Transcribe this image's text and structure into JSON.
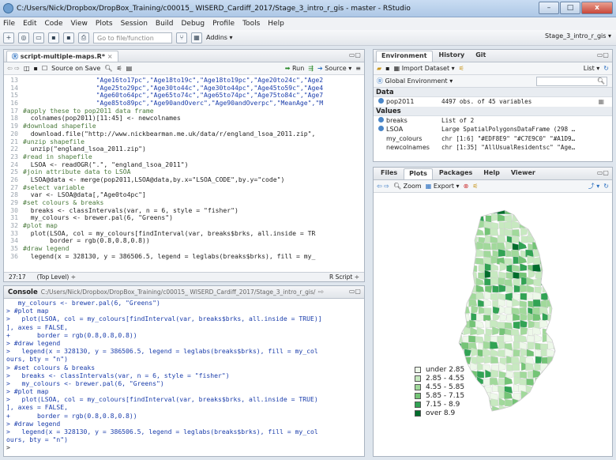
{
  "window": {
    "title": "C:/Users/Nick/Dropbox/DropBox_Training/c00015_ WISERD_Cardiff_2017/Stage_3_intro_r_gis - master - RStudio",
    "minimize": "–",
    "maximize": "□",
    "close": "x"
  },
  "menu": [
    "File",
    "Edit",
    "Code",
    "View",
    "Plots",
    "Session",
    "Build",
    "Debug",
    "Profile",
    "Tools",
    "Help"
  ],
  "toolbar": {
    "goto_placeholder": "Go to file/function",
    "addins": "Addins ▾",
    "project": "Stage_3_intro_r_gis ▾"
  },
  "editor": {
    "tab": "script-multiple-maps.R*",
    "source_on_save": "Source on Save",
    "run": "Run",
    "source": "Source ▾",
    "lines": [
      {
        "n": "13",
        "t": "                   \"Age16to17pc\",\"Age18to19c\",\"Age18to19pc\",\"Age20to24c\",\"Age2",
        "cls": "st"
      },
      {
        "n": "14",
        "t": "                   \"Age25to29pc\",\"Age30to44c\",\"Age30to44pc\",\"Age45to59c\",\"Age4",
        "cls": "st"
      },
      {
        "n": "15",
        "t": "                   \"Age60to64pc\",\"Age65to74c\",\"Age65to74pc\",\"Age75to84c\",\"Age7",
        "cls": "st"
      },
      {
        "n": "16",
        "t": "                   \"Age85to89pc\",\"Age90andOverc\",\"Age90andOverpc\",\"MeanAge\",\"M",
        "cls": "st"
      },
      {
        "n": "17",
        "t": "#apply these to pop2011 data frame",
        "cls": "cm"
      },
      {
        "n": "18",
        "t": "  colnames(pop2011)[11:45] <- newcolnames",
        "cls": ""
      },
      {
        "n": "19",
        "t": "#download shapefile",
        "cls": "cm"
      },
      {
        "n": "20",
        "t": "  download.file(\"http://www.nickbearman.me.uk/data/r/england_lsoa_2011.zip\",",
        "cls": ""
      },
      {
        "n": "21",
        "t": "#unzip shapefile",
        "cls": "cm"
      },
      {
        "n": "22",
        "t": "  unzip(\"england_lsoa_2011.zip\")",
        "cls": ""
      },
      {
        "n": "23",
        "t": "#read in shapefile",
        "cls": "cm"
      },
      {
        "n": "24",
        "t": "  LSOA <- readOGR(\".\", \"england_lsoa_2011\")",
        "cls": ""
      },
      {
        "n": "25",
        "t": "#join attribute data to LSOA",
        "cls": "cm"
      },
      {
        "n": "26",
        "t": "  LSOA@data <- merge(pop2011,LSOA@data,by.x=\"LSOA_CODE\",by.y=\"code\")",
        "cls": ""
      },
      {
        "n": "27",
        "t": "#select variable",
        "cls": "cm"
      },
      {
        "n": "28",
        "t": "  var <- LSOA@data[,\"Age0to4pc\"]",
        "cls": ""
      },
      {
        "n": "29",
        "t": "#set colours & breaks",
        "cls": "cm"
      },
      {
        "n": "30",
        "t": "  breaks <- classIntervals(var, n = 6, style = \"fisher\")",
        "cls": ""
      },
      {
        "n": "31",
        "t": "  my_colours <- brewer.pal(6, \"Greens\")",
        "cls": ""
      },
      {
        "n": "32",
        "t": "#plot map",
        "cls": "cm"
      },
      {
        "n": "33",
        "t": "  plot(LSOA, col = my_colours[findInterval(var, breaks$brks, all.inside = TR",
        "cls": ""
      },
      {
        "n": "34",
        "t": "       border = rgb(0.8,0.8,0.8))",
        "cls": ""
      },
      {
        "n": "35",
        "t": "#draw legend",
        "cls": "cm"
      },
      {
        "n": "36",
        "t": "  legend(x = 328130, y = 386506.5, legend = leglabs(breaks$brks), fill = my_",
        "cls": ""
      }
    ],
    "status_pos": "27:17",
    "status_scope": "(Top Level) ÷",
    "status_type": "R Script ÷"
  },
  "console": {
    "title": "Console",
    "path": "C:/Users/Nick/Dropbox/DropBox_Training/c00015_ WISERD_Cardiff_2017/Stage_3_intro_r_gis/",
    "lines": [
      "   my_colours <- brewer.pal(6, \"Greens\")",
      "> #plot map",
      ">   plot(LSOA, col = my_colours[findInterval(var, breaks$brks, all.inside = TRUE)]",
      "], axes = FALSE,",
      "+       border = rgb(0.8,0.8,0.8))",
      "> #draw legend",
      ">   legend(x = 328130, y = 386506.5, legend = leglabs(breaks$brks), fill = my_col",
      "ours, bty = \"n\")",
      "> #set colours & breaks",
      ">   breaks <- classIntervals(var, n = 6, style = \"fisher\")",
      ">   my_colours <- brewer.pal(6, \"Greens\")",
      "> #plot map",
      ">   plot(LSOA, col = my_colours[findInterval(var, breaks$brks, all.inside = TRUE)",
      "], axes = FALSE,",
      "+       border = rgb(0.8,0.8,0.8))",
      "> #draw legend",
      ">   legend(x = 328130, y = 386506.5, legend = leglabs(breaks$brks), fill = my_col",
      "ours, bty = \"n\")",
      "> "
    ]
  },
  "environment": {
    "tabs": [
      "Environment",
      "History",
      "Git"
    ],
    "import": "Import Dataset ▾",
    "list": "List ▾",
    "global": "Global Environment ▾",
    "data_header": "Data",
    "values_header": "Values",
    "data_rows": [
      {
        "name": "pop2011",
        "value": "4497 obs. of 45 variables"
      }
    ],
    "value_rows": [
      {
        "name": "breaks",
        "value": "List of 2"
      },
      {
        "name": "LSOA",
        "value": "Large SpatialPolygonsDataFrame (298 …"
      },
      {
        "name": "my_colours",
        "value": "chr [1:6] \"#EDF8E9\" \"#C7E9C0\" \"#A1D9…"
      },
      {
        "name": "newcolnames",
        "value": "chr [1:35] \"AllUsualResidentsc\" \"Age…"
      }
    ]
  },
  "plots": {
    "tabs": [
      "Files",
      "Plots",
      "Packages",
      "Help",
      "Viewer"
    ],
    "zoom": "Zoom",
    "export": "Export ▾",
    "legend": [
      {
        "label": "under 2.85",
        "color": "#edf8e9"
      },
      {
        "label": "2.85 - 4.55",
        "color": "#c7e9c0"
      },
      {
        "label": "4.55 - 5.85",
        "color": "#a1d99b"
      },
      {
        "label": "5.85 - 7.15",
        "color": "#74c476"
      },
      {
        "label": "7.15 - 8.9",
        "color": "#31a354"
      },
      {
        "label": "over 8.9",
        "color": "#006d2c"
      }
    ]
  }
}
